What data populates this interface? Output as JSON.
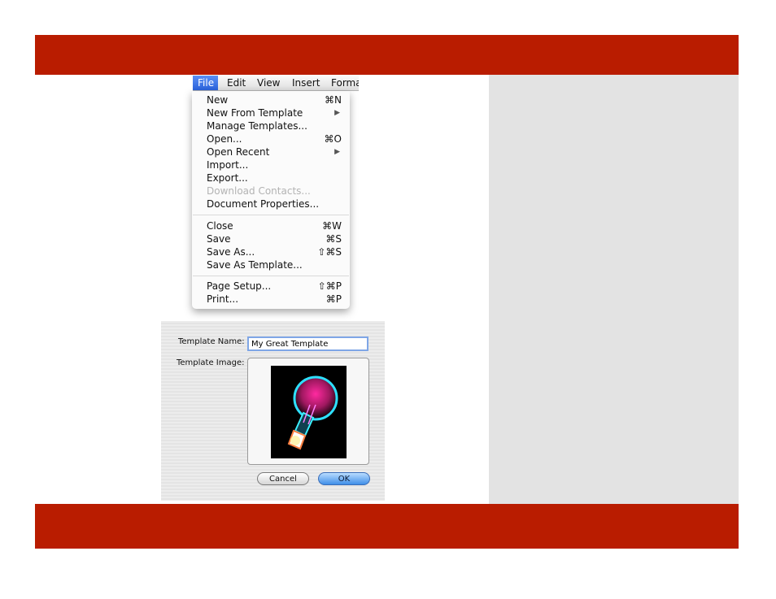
{
  "menubar": {
    "items": [
      {
        "label": "File"
      },
      {
        "label": "Edit"
      },
      {
        "label": "View"
      },
      {
        "label": "Insert"
      },
      {
        "label": "Forma"
      }
    ]
  },
  "file_menu": {
    "items": [
      {
        "label": "New",
        "shortcut": "⌘N"
      },
      {
        "label": "New From Template",
        "submenu_arrow": "▶"
      },
      {
        "label": "Manage Templates..."
      },
      {
        "label": "Open...",
        "shortcut": "⌘O"
      },
      {
        "label": "Open Recent",
        "submenu_arrow": "▶"
      },
      {
        "label": "Import..."
      },
      {
        "label": "Export..."
      },
      {
        "label": "Download Contacts...",
        "disabled": true
      },
      {
        "label": "Document Properties..."
      },
      {
        "label": "Close",
        "shortcut": "⌘W"
      },
      {
        "label": "Save",
        "shortcut": "⌘S"
      },
      {
        "label": "Save As...",
        "shortcut": "⇧⌘S"
      },
      {
        "label": "Save As Template..."
      },
      {
        "label": "Page Setup...",
        "shortcut": "⇧⌘P"
      },
      {
        "label": "Print...",
        "shortcut": "⌘P"
      }
    ]
  },
  "dialog": {
    "name_label": "Template Name:",
    "name_value": "My Great Template",
    "image_label": "Template Image:",
    "image_icon": "lightbulb-image",
    "cancel_label": "Cancel",
    "ok_label": "OK"
  },
  "colors": {
    "band": "#b91c00",
    "menu_highlight": "#3a72e8",
    "side_panel": "#e3e3e3"
  }
}
